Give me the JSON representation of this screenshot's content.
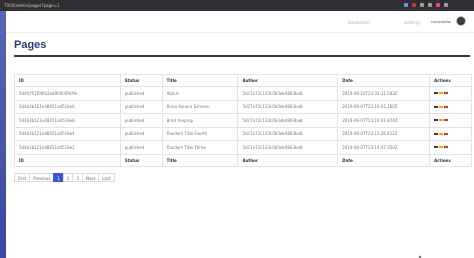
{
  "browser": {
    "url": "7000/admin/pages?page=1",
    "extensions": [
      "#7a8cff",
      "#c0392b",
      "#9e9e9e",
      "#9e9e9e",
      "#e84393",
      "#9e9e9e"
    ]
  },
  "topnav": {
    "links": [
      "Dashboard",
      "Settings"
    ],
    "user": "computebo"
  },
  "page": {
    "title": "Pages"
  },
  "table": {
    "headers": [
      "ID",
      "Status",
      "Title",
      "Author",
      "Date",
      "Actions"
    ],
    "rows": [
      {
        "id": "5d4fcf51f06fa2a4900009c9e",
        "status": "published",
        "title": "About",
        "author": "5d27a72c133c0b3eb4863ba8",
        "date": "2019-08-10T23:33:31.583Z"
      },
      {
        "id": "5d4b3b121e48651a4518e6",
        "status": "published",
        "title": "Brian Azuera Esmenu",
        "author": "5d27a72c133c0b3eb4863ba8",
        "date": "2019-08-07T23:16:02.160Z"
      },
      {
        "id": "5d4b3b121e48651a4518e8",
        "status": "published",
        "title": "Brad Yeoprep",
        "author": "5d27a72c133c0b3eb4863ba8",
        "date": "2019-08-07T23:16:01.874Z"
      },
      {
        "id": "5d4b3b121e48651a4518e4",
        "status": "published",
        "title": "Random Title Fourth",
        "author": "5d27a72c133c0b3eb4863ba8",
        "date": "2019-08-07T23:15:26.412Z"
      },
      {
        "id": "5d4b3b121e48651a4518e2",
        "status": "published",
        "title": "Random Title Three",
        "author": "5d27a72c133c0b3eb4863ba8",
        "date": "2019-08-07T23:14:47.350Z"
      }
    ],
    "action_colors": [
      "#3b3b3b",
      "#e0a800",
      "#d63031"
    ]
  },
  "pagination": {
    "items": [
      "First",
      "Previous",
      "1",
      "2",
      "3",
      "Next",
      "Last"
    ],
    "active": "1"
  }
}
